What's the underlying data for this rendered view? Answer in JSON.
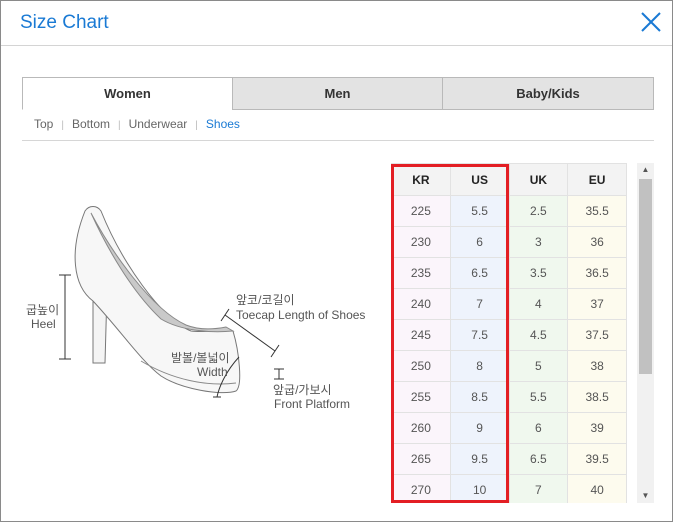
{
  "dialog": {
    "title": "Size Chart"
  },
  "tabs": [
    {
      "label": "Women",
      "active": true
    },
    {
      "label": "Men",
      "active": false
    },
    {
      "label": "Baby/Kids",
      "active": false
    }
  ],
  "subnav": [
    {
      "label": "Top",
      "active": false
    },
    {
      "label": "Bottom",
      "active": false
    },
    {
      "label": "Underwear",
      "active": false
    },
    {
      "label": "Shoes",
      "active": true
    }
  ],
  "diagram": {
    "heel_kr": "굽높이",
    "heel_en": "Heel",
    "toecap_kr": "앞코/코길이",
    "toecap_en": "Toecap Length of Shoes",
    "width_kr": "발볼/볼넓이",
    "width_en": "Width",
    "platform_kr": "앞굽/가보시",
    "platform_en": "Front Platform"
  },
  "size_table": {
    "headers": [
      "KR",
      "US",
      "UK",
      "EU"
    ],
    "rows": [
      [
        "225",
        "5.5",
        "2.5",
        "35.5"
      ],
      [
        "230",
        "6",
        "3",
        "36"
      ],
      [
        "235",
        "6.5",
        "3.5",
        "36.5"
      ],
      [
        "240",
        "7",
        "4",
        "37"
      ],
      [
        "245",
        "7.5",
        "4.5",
        "37.5"
      ],
      [
        "250",
        "8",
        "5",
        "38"
      ],
      [
        "255",
        "8.5",
        "5.5",
        "38.5"
      ],
      [
        "260",
        "9",
        "6",
        "39"
      ],
      [
        "265",
        "9.5",
        "6.5",
        "39.5"
      ],
      [
        "270",
        "10",
        "7",
        "40"
      ]
    ]
  },
  "colors": {
    "accent": "#1a7ad4",
    "highlight": "#e31e24",
    "kr_col": "#fbf5fb",
    "us_col": "#eef3fc",
    "uk_col": "#f0f8ee",
    "eu_col": "#fdfbee"
  }
}
